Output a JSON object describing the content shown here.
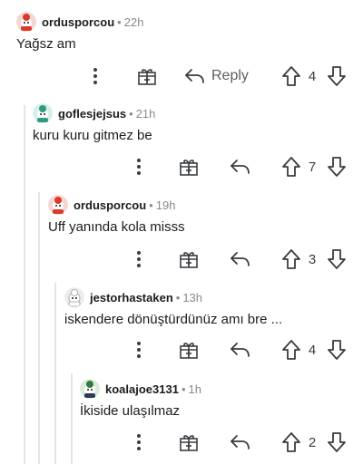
{
  "comments": [
    {
      "username": "ordusporcou",
      "time": "22h",
      "body": "Yağsz am",
      "votes": "4",
      "reply_label": "Reply",
      "avatar": "red-snoo-avatar"
    },
    {
      "username": "goflesjejsus",
      "time": "21h",
      "body": "kuru kuru gitmez be",
      "votes": "7",
      "avatar": "teal-snoo-avatar"
    },
    {
      "username": "ordusporcou",
      "time": "19h",
      "body": "Uff yanında kola misss",
      "votes": "3",
      "avatar": "red-snoo-avatar"
    },
    {
      "username": "jestorhastaken",
      "time": "13h",
      "body": "iskendere dönüştürdünüz amı bre ...",
      "votes": "4",
      "avatar": "gray-snoo-avatar"
    },
    {
      "username": "koalajoe3131",
      "time": "1h",
      "body": "İkiside ulaşılmaz",
      "votes": "2",
      "avatar": "green-snoo-avatar"
    }
  ],
  "separator": "•",
  "icons": {
    "more": "more-vertical-icon",
    "award": "award-gift-icon",
    "reply": "reply-arrow-icon",
    "upvote": "upvote-arrow-icon",
    "downvote": "downvote-arrow-icon"
  },
  "colors": {
    "text": "#1c1c1c",
    "meta": "#878a8c",
    "icon": "#5a5d60",
    "thread_line": "#e2e4e6"
  }
}
